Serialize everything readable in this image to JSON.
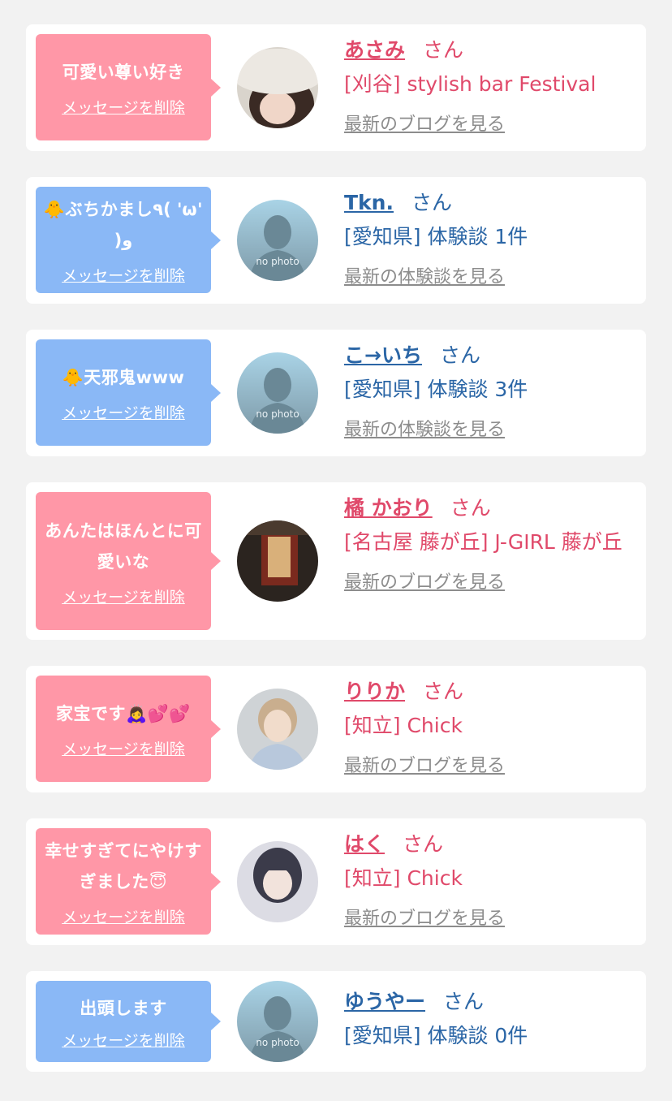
{
  "suffix": "さん",
  "delete_label": "メッセージを削除",
  "items": [
    {
      "message": "可愛い尊い好き",
      "name": "あさみ",
      "sub": "[刈谷] stylish bar Festival",
      "link": "最新のブログを見る"
    },
    {
      "message": "🐥ぶちかまし٩( 'ω' )و",
      "name": "Tkn.",
      "sub": "[愛知県] 体験談 1件",
      "link": "最新の体験談を見る"
    },
    {
      "message": "🐥天邪鬼www",
      "name": "こ→いち",
      "sub": "[愛知県] 体験談 3件",
      "link": "最新の体験談を見る"
    },
    {
      "message": "あんたはほんとに可愛いな",
      "name": "橘 かおり",
      "sub": "[名古屋 藤が丘] J-GIRL 藤が丘",
      "link": "最新のブログを見る"
    },
    {
      "message": "家宝です🙇‍♀️💕💕",
      "name": "りりか",
      "sub": "[知立] Chick",
      "link": "最新のブログを見る"
    },
    {
      "message": "幸せすぎてにやけすぎました😇",
      "name": "はく",
      "sub": "[知立] Chick",
      "link": "最新のブログを見る"
    },
    {
      "message": "出頭します",
      "name": "ゆうやー",
      "sub": "[愛知県] 体験談 0件",
      "link": ""
    }
  ],
  "no_photo_text": "no photo",
  "colors": {
    "pink_bubble": "#ff97a7",
    "blue_bubble": "#8ab8f6",
    "pink_text": "#e0496a",
    "blue_text": "#2b66a6",
    "link_gray": "#8c8c8c"
  }
}
